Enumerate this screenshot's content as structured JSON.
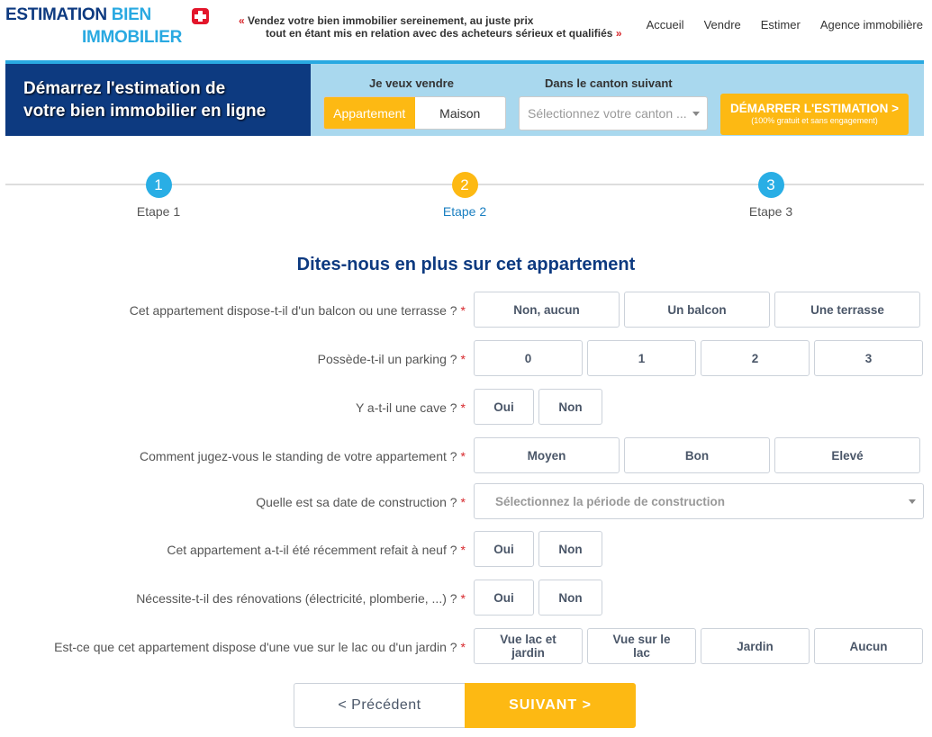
{
  "header": {
    "logo": {
      "word1": "ESTIMATION",
      "word2": "BIEN",
      "word3": "IMMOBILIER",
      "flag_icon": "swiss-flag-icon"
    },
    "tagline": {
      "open_quote": "«",
      "line1": "Vendez votre bien immobilier sereinement, au juste prix",
      "line2": "tout en étant mis en relation avec des acheteurs sérieux et qualifiés",
      "close_quote": "»"
    },
    "nav": [
      "Accueil",
      "Vendre",
      "Estimer",
      "Agence immobilière"
    ]
  },
  "banner": {
    "title_line1": "Démarrez l'estimation de",
    "title_line2": "votre bien immobilier en ligne",
    "sell_label": "Je veux vendre",
    "sell_options": [
      {
        "label": "Appartement",
        "selected": true
      },
      {
        "label": "Maison",
        "selected": false
      }
    ],
    "canton_label": "Dans le canton suivant",
    "canton_placeholder": "Sélectionnez votre canton ...",
    "start_button": {
      "main": "DÉMARRER L'ESTIMATION >",
      "sub": "(100% gratuit et sans engagement)"
    }
  },
  "stepper": {
    "current": 2,
    "steps": [
      {
        "number": "1",
        "label": "Etape 1"
      },
      {
        "number": "2",
        "label": "Etape 2"
      },
      {
        "number": "3",
        "label": "Etape 3"
      }
    ]
  },
  "form": {
    "title": "Dites-nous en plus sur cet appartement",
    "required_mark": "*",
    "questions": [
      {
        "label": "Cet appartement dispose-t-il d'un balcon ou une terrasse ?",
        "options": [
          "Non, aucun",
          "Un balcon",
          "Une terrasse"
        ]
      },
      {
        "label": "Possède-t-il un parking ?",
        "options": [
          "0",
          "1",
          "2",
          "3"
        ]
      },
      {
        "label": "Y a-t-il une cave ?",
        "options": [
          "Oui",
          "Non"
        ]
      },
      {
        "label": "Comment jugez-vous le standing de votre appartement ?",
        "options": [
          "Moyen",
          "Bon",
          "Elevé"
        ]
      },
      {
        "label": "Quelle est sa date de construction ?",
        "placeholder": "Sélectionnez la période de construction"
      },
      {
        "label": "Cet appartement a-t-il été récemment refait à neuf ?",
        "options": [
          "Oui",
          "Non"
        ]
      },
      {
        "label": "Nécessite-t-il des rénovations (électricité, plomberie, ...) ?",
        "options": [
          "Oui",
          "Non"
        ]
      },
      {
        "label": "Est-ce que cet appartement dispose d'une vue sur le lac ou d'un jardin ?",
        "options": [
          "Vue lac et jardin",
          "Vue sur le lac",
          "Jardin",
          "Aucun"
        ]
      }
    ]
  },
  "navigation": {
    "previous": "<  Précédent",
    "next": "SUIVANT  >"
  },
  "colors": {
    "brand_dark_blue": "#0d3a80",
    "brand_light_blue": "#29a9e1",
    "accent_yellow": "#fdb913",
    "banner_bg": "#a9d8ee"
  }
}
